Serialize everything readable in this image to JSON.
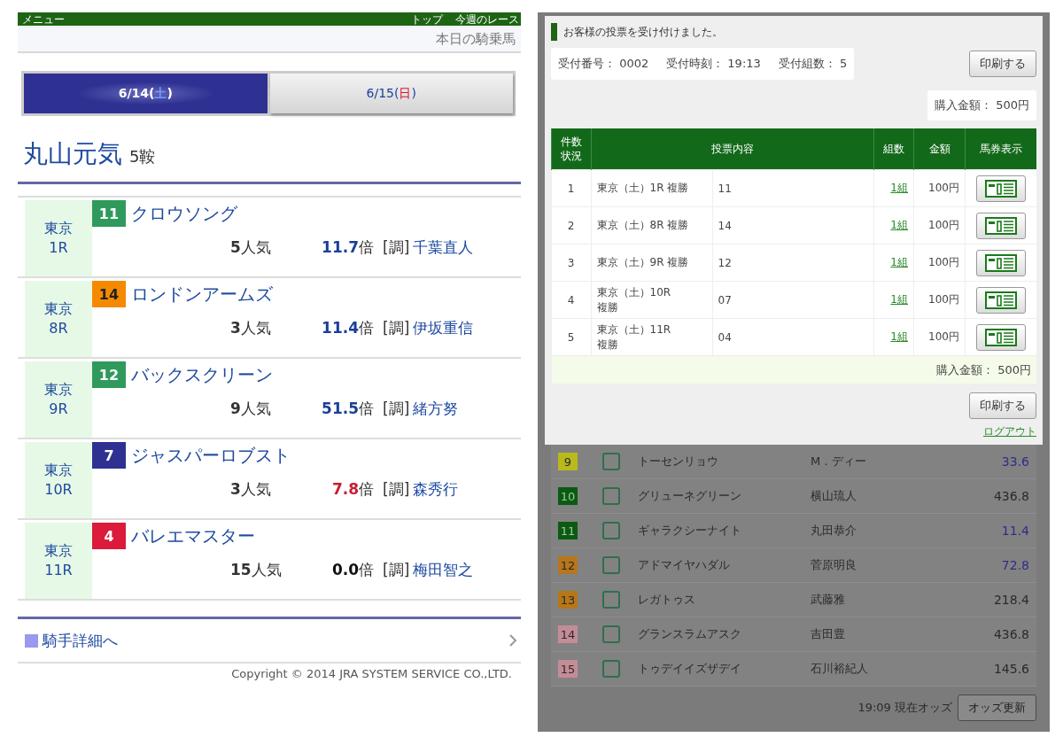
{
  "left": {
    "header": {
      "menu": "メニュー",
      "links": [
        "トップ",
        "今週のレース"
      ]
    },
    "subheader": "本日の騎乗馬",
    "tabs": [
      {
        "date": "6/14(",
        "day": {
          "text": "土",
          "color": "#6f9cff"
        },
        "close": ")",
        "selected": true
      },
      {
        "date": "6/15(",
        "day": {
          "text": "日",
          "color": "#d4182c"
        },
        "close": ")",
        "selected": false
      }
    ],
    "jockey": {
      "name": "丸山元気",
      "count": "5鞍"
    },
    "rides": [
      {
        "venue": "東京",
        "race": "1R",
        "number": "11",
        "color": "#2f9a5c",
        "horse": "クロウソング",
        "popularity": "**5**人気",
        "odds": {
          "text": "**11.7**倍",
          "color": "#1b3f98"
        },
        "trainer_mark": "[調]",
        "trainer": "千葉直人"
      },
      {
        "venue": "東京",
        "race": "8R",
        "number": "14",
        "color": "#f58a00",
        "horse": "ロンドンアームズ",
        "popularity": "**3**人気",
        "odds": {
          "text": "**11.4**倍",
          "color": "#1b3f98"
        },
        "trainer_mark": "[調]",
        "trainer": "伊坂重信"
      },
      {
        "venue": "東京",
        "race": "9R",
        "number": "12",
        "color": "#2f9a5c",
        "horse": "バックスクリーン",
        "popularity": "**9**人気",
        "odds": {
          "text": "**51.5**倍",
          "color": "#1b3f98"
        },
        "trainer_mark": "[調]",
        "trainer": "緒方努"
      },
      {
        "venue": "東京",
        "race": "10R",
        "number": "7",
        "color": "#2e3192",
        "horse": "ジャスパーロブスト",
        "popularity": "**3**人気",
        "odds": {
          "text": "**7.8**倍",
          "color": "#c81e32"
        },
        "trainer_mark": "[調]",
        "trainer": "森秀行"
      },
      {
        "venue": "東京",
        "race": "11R",
        "number": "4",
        "color": "#dc1a3c",
        "horse": "バレエマスター",
        "popularity": "**15**人気",
        "odds": {
          "text": "**0.0**倍",
          "color": "#111111"
        },
        "trainer_mark": "[調]",
        "trainer": "梅田智之"
      }
    ],
    "detail_link": "騎手詳細へ",
    "copyright": "Copyright © 2014 JRA SYSTEM SERVICE CO.,LTD."
  },
  "right": {
    "receipt": {
      "message": "お客様の投票を受け付けました。",
      "info": [
        "受付番号： 0002",
        "受付時刻： 19:13",
        "受付組数： 5"
      ],
      "print_button": "印刷する",
      "total": "購入金額： 500円",
      "columns": [
        "件数状況",
        "投票内容",
        "組数",
        "金額",
        "馬券表示"
      ],
      "rows": [
        {
          "no": "1",
          "race": "東京（土）1R 複勝",
          "selection": "11",
          "count": "1組",
          "amount": "100円"
        },
        {
          "no": "2",
          "race": "東京（土）8R 複勝",
          "selection": "14",
          "count": "1組",
          "amount": "100円"
        },
        {
          "no": "3",
          "race": "東京（土）9R 複勝",
          "selection": "12",
          "count": "1組",
          "amount": "100円"
        },
        {
          "no": "4",
          "race": "東京（土）10R\n複勝",
          "selection": "07",
          "count": "1組",
          "amount": "100円"
        },
        {
          "no": "5",
          "race": "東京（土）11R\n複勝",
          "selection": "04",
          "count": "1組",
          "amount": "100円"
        }
      ],
      "footer_total": "購入金額： 500円",
      "print_button_2": "印刷する",
      "logout": "ログアウト"
    },
    "odds_list": {
      "rows": [
        {
          "number": "9",
          "color": "#b9b91c",
          "checked": false,
          "horse": "トーセンリョウ",
          "jockey": "M．ディー",
          "odds": "33.6",
          "highlighted": true
        },
        {
          "number": "10",
          "color": "#0b5a12",
          "checked": false,
          "horse": "グリューネグリーン",
          "jockey": "横山琉人",
          "odds": "436.8",
          "highlighted": false
        },
        {
          "number": "11",
          "color": "#0b5a12",
          "checked": false,
          "horse": "ギャラクシーナイト",
          "jockey": "丸田恭介",
          "odds": "11.4",
          "highlighted": true
        },
        {
          "number": "12",
          "color": "#b7761a",
          "checked": false,
          "horse": "アドマイヤハダル",
          "jockey": "菅原明良",
          "odds": "72.8",
          "highlighted": true
        },
        {
          "number": "13",
          "color": "#b7761a",
          "checked": false,
          "horse": "レガトゥス",
          "jockey": "武藤雅",
          "odds": "218.4",
          "highlighted": false
        },
        {
          "number": "14",
          "color": "#c48c96",
          "checked": false,
          "horse": "グランスラムアスク",
          "jockey": "吉田豊",
          "odds": "436.8",
          "highlighted": false
        },
        {
          "number": "15",
          "color": "#c48c96",
          "checked": false,
          "horse": "トゥデイイズザデイ",
          "jockey": "石川裕紀人",
          "odds": "145.6",
          "highlighted": false
        }
      ],
      "updated": "19:09 現在オッズ",
      "refresh_button": "オッズ更新"
    }
  }
}
